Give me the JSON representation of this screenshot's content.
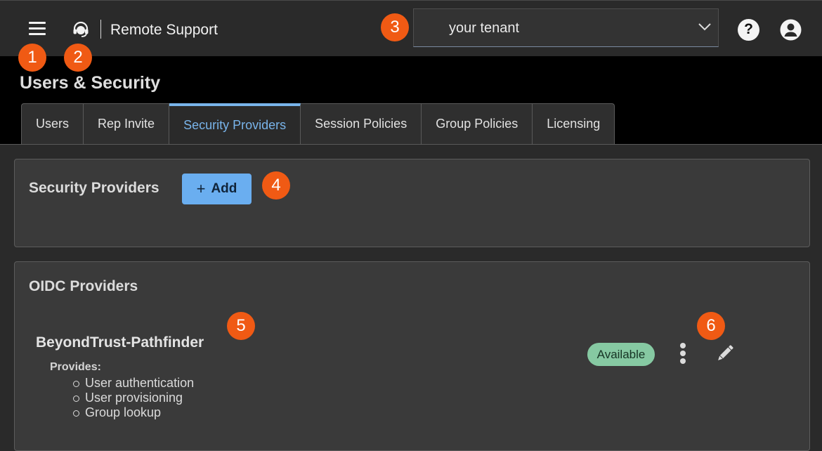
{
  "topbar": {
    "brand_name": "Remote Support",
    "tenant_value": "your tenant"
  },
  "page": {
    "title": "Users & Security"
  },
  "tabs": [
    {
      "label": "Users",
      "active": false
    },
    {
      "label": "Rep Invite",
      "active": false
    },
    {
      "label": "Security Providers",
      "active": true
    },
    {
      "label": "Session Policies",
      "active": false
    },
    {
      "label": "Group Policies",
      "active": false
    },
    {
      "label": "Licensing",
      "active": false
    }
  ],
  "security_providers": {
    "title": "Security Providers",
    "add_plus": "+",
    "add_label": "Add"
  },
  "oidc": {
    "title": "OIDC Providers",
    "provider": {
      "name": "BeyondTrust-Pathfinder",
      "provides_label": "Provides:",
      "provides": [
        "User authentication",
        "User provisioning",
        "Group lookup"
      ],
      "status": "Available"
    }
  },
  "callouts": [
    "1",
    "2",
    "3",
    "4",
    "5",
    "6"
  ],
  "icons": {
    "menu": "hamburger-menu-icon",
    "logo": "headset-icon",
    "chevron": "chevron-down-icon",
    "help": "help-icon",
    "user": "user-account-icon",
    "more": "more-vertical-icon",
    "edit": "pencil-icon"
  },
  "colors": {
    "accent": "#79b4ea",
    "add_button": "#6aaef0",
    "status_available": "#86c9a2",
    "callout": "#f05a14"
  }
}
